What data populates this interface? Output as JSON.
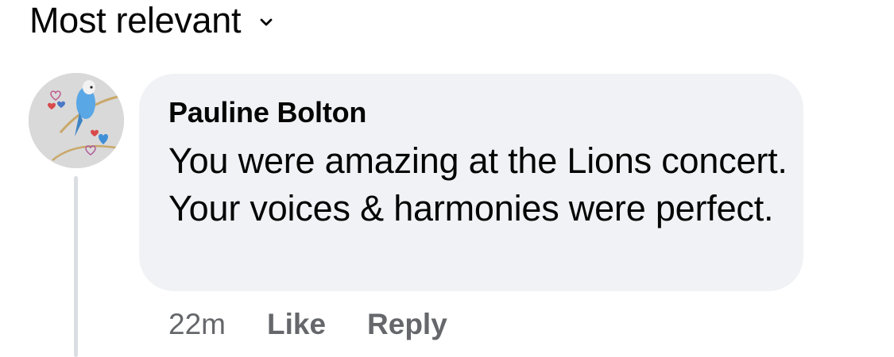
{
  "sort": {
    "label": "Most relevant",
    "icon": "chevron-down-icon"
  },
  "comment": {
    "author": "Pauline Bolton",
    "avatar_icon": "budgie-avatar",
    "text": "You were amazing at the Lions concert. Your voices & harmonies were perfect.",
    "timestamp": "22m",
    "like_label": "Like",
    "reply_label": "Reply"
  },
  "colors": {
    "bubble": "#f0f2f5",
    "text": "#050505",
    "secondary": "#65676b",
    "thread_line": "#dadde1"
  }
}
